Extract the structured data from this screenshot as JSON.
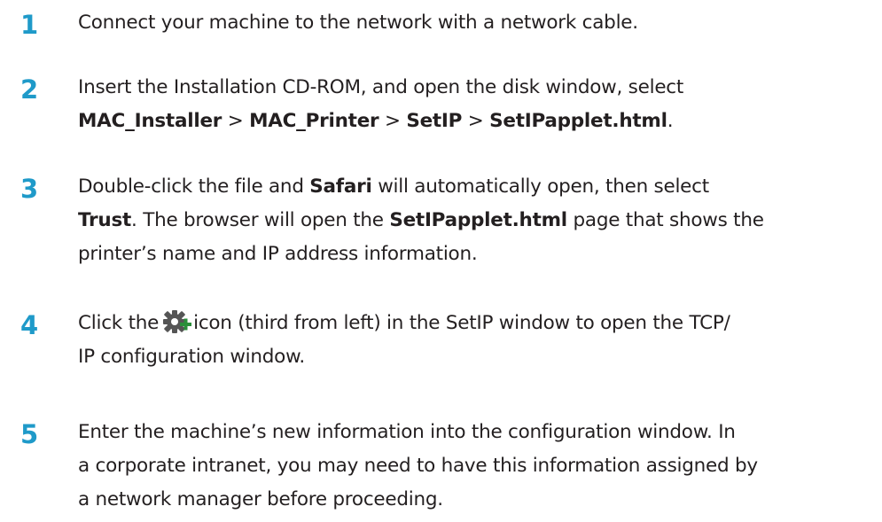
{
  "steps": [
    {
      "number": "1",
      "lines": [
        {
          "pre": "Connect your machine to the network with a network cable."
        }
      ]
    },
    {
      "number": "2",
      "lines": [
        {
          "pre": "Insert the Installation CD-ROM, and open the disk window, select"
        },
        {
          "b1": "MAC_Installer",
          "s1": " > ",
          "b2": "MAC_Printer",
          "s2": " > ",
          "b3": "SetIP",
          "s3": " > ",
          "b4": "SetIPapplet.html",
          "s4": "."
        }
      ]
    },
    {
      "number": "3",
      "lines": [
        {
          "pre": "Double-click the file and ",
          "b1": "Safari",
          "post": " will automatically open, then select"
        },
        {
          "b1": "Trust",
          "mid": ". The browser will open the ",
          "b2": "SetIPapplet.html",
          "post": " page that shows the"
        },
        {
          "pre": "printer’s name and IP address information."
        }
      ]
    },
    {
      "number": "4",
      "icon": "gear-plus-icon",
      "lines": [
        {
          "pre": "Click the",
          "post": "icon (third from left) in the SetIP window to open the TCP/"
        },
        {
          "pre": "IP configuration window."
        }
      ]
    },
    {
      "number": "5",
      "lines": [
        {
          "pre": "Enter the machine’s new information into the configuration window. In"
        },
        {
          "pre": "a corporate intranet, you may need to have this information assigned by"
        },
        {
          "pre": "a network manager before proceeding."
        }
      ]
    }
  ],
  "colors": {
    "step_number": "#1f9ac9",
    "text": "#231f20",
    "icon_gear": "#555555",
    "icon_plus": "#2a8f3a"
  }
}
